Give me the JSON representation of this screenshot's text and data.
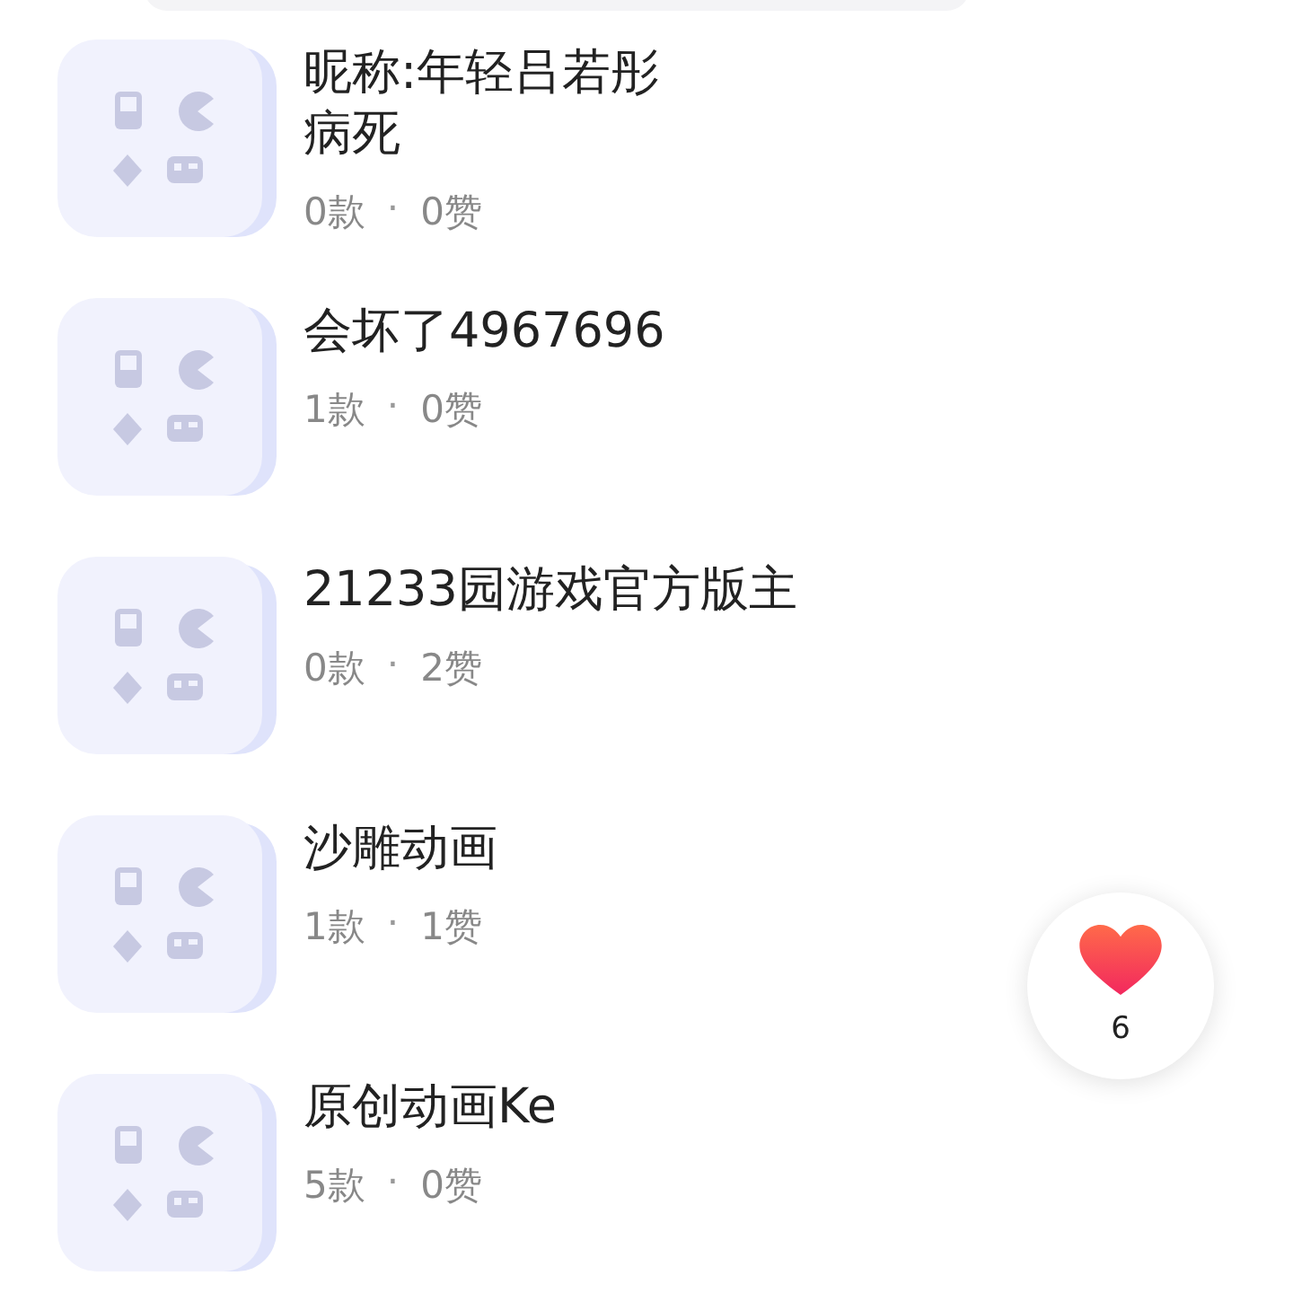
{
  "items": [
    {
      "title": [
        "昵称:年轻吕若彤",
        "病死"
      ],
      "games": "0款",
      "separator": "·",
      "likes": "0赞"
    },
    {
      "title": [
        "会坏了4967696"
      ],
      "games": "1款",
      "separator": "·",
      "likes": "0赞"
    },
    {
      "title": [
        "21233园游戏官方版主"
      ],
      "games": "0款",
      "separator": "·",
      "likes": "2赞"
    },
    {
      "title": [
        "沙雕动画"
      ],
      "games": "1款",
      "separator": "·",
      "likes": "1赞"
    },
    {
      "title": [
        "原创动画Ke"
      ],
      "games": "5款",
      "separator": "·",
      "likes": "0赞"
    }
  ],
  "like_button": {
    "count": "6"
  }
}
